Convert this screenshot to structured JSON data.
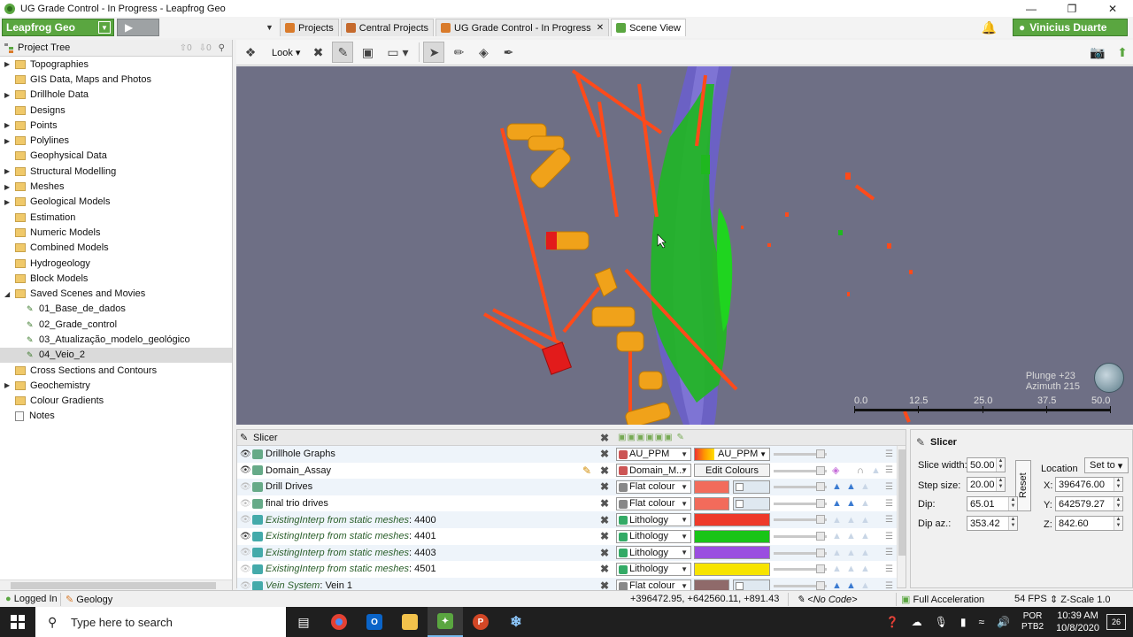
{
  "window": {
    "title": "UG Grade Control - In Progress - Leapfrog Geo",
    "minimize": "—",
    "maximize": "❐",
    "close": "✕"
  },
  "toolbar": {
    "app_menu_label": "Leapfrog Geo",
    "tabs": [
      {
        "label": "Projects",
        "color": "#d97b2b"
      },
      {
        "label": "Central Projects",
        "color": "#c56a2d"
      },
      {
        "label": "UG Grade Control - In Progress",
        "color": "#d97b2b",
        "close": "✕"
      },
      {
        "label": "Scene View",
        "color": "#5aa640"
      }
    ],
    "user_label": "Vinicius Duarte"
  },
  "project_tree": {
    "title": "Project Tree",
    "back_count": "0",
    "fwd_count": "0",
    "items": [
      {
        "label": "Topographies",
        "expandable": true
      },
      {
        "label": "GIS Data, Maps and Photos",
        "expandable": false
      },
      {
        "label": "Drillhole Data",
        "expandable": true
      },
      {
        "label": "Designs",
        "expandable": false
      },
      {
        "label": "Points",
        "expandable": true
      },
      {
        "label": "Polylines",
        "expandable": true
      },
      {
        "label": "Geophysical Data",
        "expandable": false
      },
      {
        "label": "Structural Modelling",
        "expandable": true
      },
      {
        "label": "Meshes",
        "expandable": true
      },
      {
        "label": "Geological Models",
        "expandable": true
      },
      {
        "label": "Estimation",
        "expandable": false
      },
      {
        "label": "Numeric Models",
        "expandable": false
      },
      {
        "label": "Combined Models",
        "expandable": false
      },
      {
        "label": "Hydrogeology",
        "expandable": false
      },
      {
        "label": "Block Models",
        "expandable": false
      },
      {
        "label": "Saved Scenes and Movies",
        "expandable": true,
        "expanded": true
      }
    ],
    "saved_scenes": [
      "01_Base_de_dados",
      "02_Grade_control",
      "03_Atualização_modelo_geológico",
      "04_Veio_2"
    ],
    "items_after": [
      {
        "label": "Cross Sections and Contours",
        "expandable": false
      },
      {
        "label": "Geochemistry",
        "expandable": true
      },
      {
        "label": "Colour Gradients",
        "expandable": false
      },
      {
        "label": "Notes",
        "expandable": false,
        "notes": true
      }
    ]
  },
  "scene_toolbar": {
    "look_label": "Look"
  },
  "scene": {
    "orientation_plunge": "Plunge +23",
    "orientation_azimuth": "Azimuth 215",
    "scale_labels": [
      "0.0",
      "12.5",
      "25.0",
      "37.5",
      "50.0"
    ]
  },
  "shapes_list": {
    "header_label": "Slicer",
    "rows": [
      {
        "name": "Drillhole Graphs",
        "italic": false,
        "visible": true,
        "combo": "AU_PPM",
        "swatch_type": "gradient",
        "swatch_label": "AU_PPM"
      },
      {
        "name": "Domain_Assay",
        "italic": false,
        "visible": true,
        "combo": "Domain_M...",
        "swatch_type": "button",
        "swatch_label": "Edit Colours"
      },
      {
        "name": "Drill Drives",
        "italic": false,
        "visible": false,
        "combo": "Flat colour",
        "swatch_type": "color",
        "color": "#f26b5b"
      },
      {
        "name": "final trio drives",
        "italic": false,
        "visible": false,
        "combo": "Flat colour",
        "swatch_type": "color",
        "color": "#f26b5b"
      },
      {
        "name_italic": "ExistingInterp from static meshes",
        "name_suffix": ": 4400",
        "visible": false,
        "combo": "Lithology",
        "swatch_type": "color",
        "color": "#ee3a2a"
      },
      {
        "name_italic": "ExistingInterp from static meshes",
        "name_suffix": ": 4401",
        "visible": true,
        "combo": "Lithology",
        "swatch_type": "color",
        "color": "#19c417"
      },
      {
        "name_italic": "ExistingInterp from static meshes",
        "name_suffix": ": 4403",
        "visible": false,
        "combo": "Lithology",
        "swatch_type": "color",
        "color": "#9a4ee0"
      },
      {
        "name_italic": "ExistingInterp from static meshes",
        "name_suffix": ": 4501",
        "visible": false,
        "combo": "Lithology",
        "swatch_type": "color",
        "color": "#f7e400"
      },
      {
        "name_italic": "Vein System",
        "name_suffix": ": Vein 1",
        "visible": false,
        "combo": "Flat colour",
        "swatch_type": "color",
        "color": "#8f6a6a"
      }
    ]
  },
  "slicer_panel": {
    "title": "Slicer",
    "slice_width_label": "Slice width:",
    "slice_width": "50.00",
    "step_size_label": "Step size:",
    "step_size": "20.00",
    "dip_label": "Dip:",
    "dip": "65.01",
    "dip_az_label": "Dip az.:",
    "dip_az": "353.42",
    "reset_label": "Reset",
    "location_label": "Location",
    "set_to_label": "Set to",
    "x_label": "X:",
    "x": "396476.00",
    "y_label": "Y:",
    "y": "642579.27",
    "z_label": "Z:",
    "z": "842.60"
  },
  "statusbar": {
    "logged_in": "Logged In",
    "mode": "Geology",
    "coords": "+396472.95, +642560.11, +891.43",
    "code": "<No Code>",
    "acceleration": "Full Acceleration",
    "fps": "54 FPS",
    "zscale": "Z-Scale 1.0"
  },
  "taskbar": {
    "search_placeholder": "Type here to search",
    "lang_line1": "POR",
    "lang_line2": "PTB2",
    "time": "10:39 AM",
    "date": "10/8/2020",
    "notifications": "26"
  }
}
